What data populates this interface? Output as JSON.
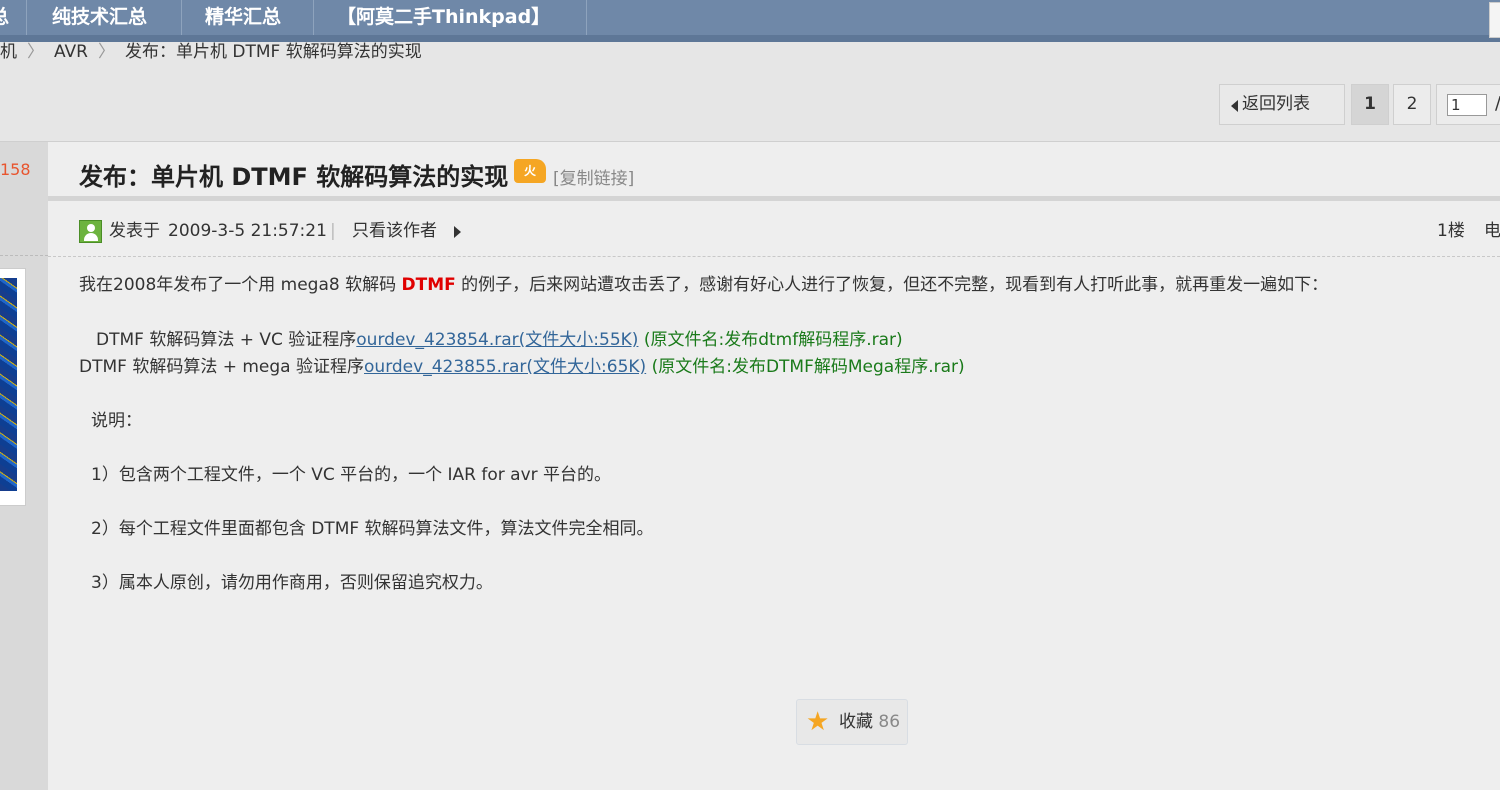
{
  "topnav": {
    "left_partial": "总",
    "items": [
      "纯技术汇总",
      "精华汇总",
      "【阿莫二手Thinkpad】"
    ]
  },
  "breadcrumb": {
    "items": [
      "机",
      "AVR",
      "发布：单片机 DTMF 软解码算法的实现"
    ],
    "separator": "〉"
  },
  "pager": {
    "back_label": "返回列表",
    "pages": [
      "1",
      "2"
    ],
    "current_page": "1",
    "input_value": "1",
    "slash": "/"
  },
  "sidebar": {
    "stat_number": "158",
    "avatar_icon": "avatar-image"
  },
  "thread": {
    "title": "发布：单片机 DTMF 软解码算法的实现",
    "hot_badge": "火",
    "copy_link": "[复制链接]"
  },
  "post": {
    "posted_label": "发表于",
    "posted_at": "2009-3-5 21:57:21",
    "separator": "|",
    "only_author": "只看该作者",
    "floor": "1楼",
    "floor_extra": "电",
    "intro_before": "我在2008年发布了一个用 mega8 软解码 ",
    "intro_highlight": "DTMF",
    "intro_after": " 的例子，后来网站遭攻击丢了，感谢有好心人进行了恢复，但还不完整，现看到有人打听此事，就再重发一遍如下：",
    "attachments": [
      {
        "prefix": "DTMF 软解码算法 + VC 验证程序",
        "link": "ourdev_423854.rar(文件大小:55K)",
        "origin": "(原文件名:发布dtmf解码程序.rar)"
      },
      {
        "prefix": "DTMF 软解码算法 + mega 验证程序",
        "link": "ourdev_423855.rar(文件大小:65K)",
        "origin": "(原文件名:发布DTMF解码Mega程序.rar)"
      }
    ],
    "notes_title": "说明：",
    "notes": [
      "1）包含两个工程文件，一个 VC 平台的，一个 IAR for avr 平台的。",
      "2）每个工程文件里面都包含 DTMF 软解码算法文件，算法文件完全相同。",
      "3）属本人原创，请勿用作商用，否则保留追究权力。"
    ]
  },
  "favorite": {
    "label": "收藏",
    "count": "86",
    "icon": "star-icon"
  },
  "colors": {
    "nav_bg": "#6f88a8",
    "highlight_red": "#e00000",
    "link_blue": "#336699",
    "origin_green": "#1a7a1a",
    "stat_orange": "#e8552e"
  }
}
